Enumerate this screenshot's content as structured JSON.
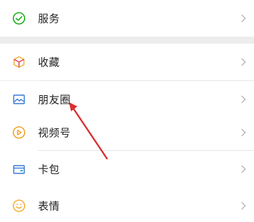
{
  "rows": [
    {
      "label": "服务",
      "icon": "wechat-pay-icon",
      "accent": "#1aad19"
    },
    {
      "label": "收藏",
      "icon": "cube-icon",
      "accent": "#f0b13e"
    },
    {
      "label": "朋友圈",
      "icon": "photo-icon",
      "accent": "#3a7ad6"
    },
    {
      "label": "视频号",
      "icon": "video-channel-icon",
      "accent": "#f2a42b"
    },
    {
      "label": "卡包",
      "icon": "card-wallet-icon",
      "accent": "#3a7ad6"
    },
    {
      "label": "表情",
      "icon": "smile-icon",
      "accent": "#f2b33a"
    }
  ],
  "colors": {
    "background": "#ededed",
    "row": "#ffffff",
    "text": "#222222",
    "chevron": "#b2b2b2",
    "annotation_arrow": "#d93030"
  }
}
